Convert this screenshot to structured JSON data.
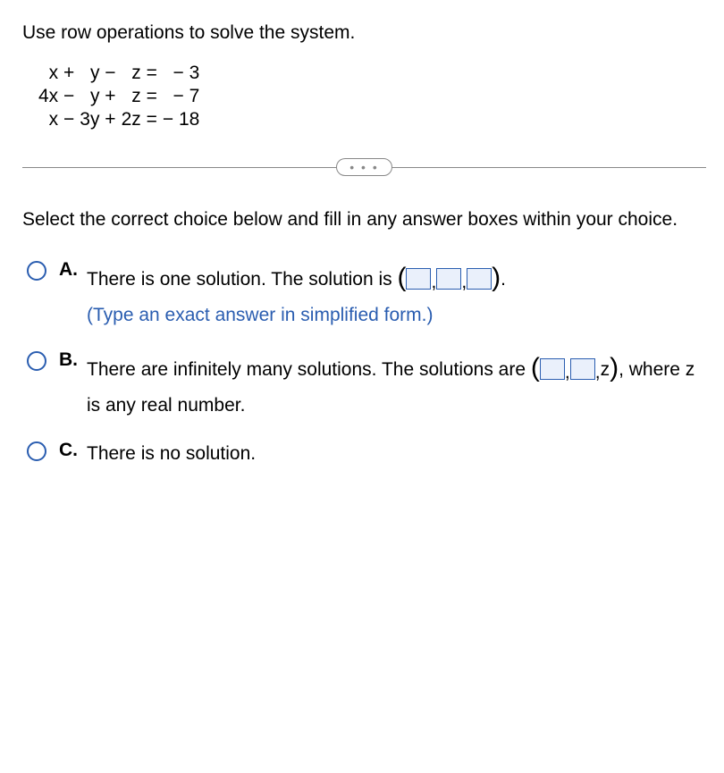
{
  "question": "Use row operations to solve the system.",
  "eq": {
    "r1c1": "x +",
    "r1c2": "y −",
    "r1c3": "z =",
    "r1c4": "− 3",
    "r2c1": "4x −",
    "r2c2": "y +",
    "r2c3": "z =",
    "r2c4": "− 7",
    "r3c1": "x −",
    "r3c2": "3y +",
    "r3c3": "2z =",
    "r3c4": "− 18"
  },
  "pill": "• • •",
  "instruction": "Select the correct choice below and fill in any answer boxes within your choice.",
  "choices": {
    "a": {
      "label": "A.",
      "text1": "There is one solution. The solution is ",
      "period": ".",
      "hint": "(Type an exact answer in simplified form.)"
    },
    "b": {
      "label": "B.",
      "text1": "There are infinitely many solutions. The solutions are ",
      "z": "z",
      "text2": ", where z is any real number."
    },
    "c": {
      "label": "C.",
      "text1": "There is no solution."
    }
  }
}
